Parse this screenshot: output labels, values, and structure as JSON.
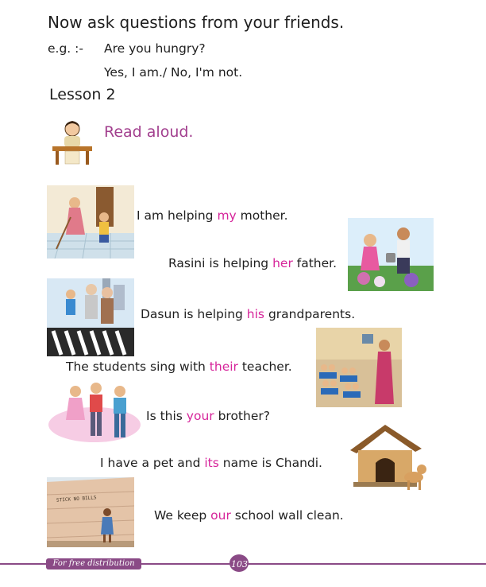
{
  "heading": "Now ask questions from your friends.",
  "example": {
    "label": "e.g. :-",
    "question": "Are you hungry?",
    "answer": "Yes, I am./ No, I'm not."
  },
  "lesson_title": "Lesson 2",
  "instruction": "Read aloud.",
  "sentences": [
    {
      "before": "I am helping ",
      "word": "my",
      "after": " mother."
    },
    {
      "before": "Rasini is helping ",
      "word": "her",
      "after": " father."
    },
    {
      "before": "Dasun is helping ",
      "word": "his",
      "after": " grandparents."
    },
    {
      "before": "The students sing with ",
      "word": "their",
      "after": " teacher."
    },
    {
      "before": "Is this ",
      "word": "your",
      "after": " brother?"
    },
    {
      "before": "I have a pet and ",
      "word": "its",
      "after": " name is Chandi."
    },
    {
      "before": "We keep ",
      "word": "our",
      "after": " school wall clean."
    }
  ],
  "wall_sign": "STICK NO BILLS",
  "footer": {
    "distribution": "For free distribution",
    "page_number": "103"
  },
  "colors": {
    "highlight": "#d6249a",
    "instruction": "#a23f8e",
    "footer": "#8a4a86"
  }
}
